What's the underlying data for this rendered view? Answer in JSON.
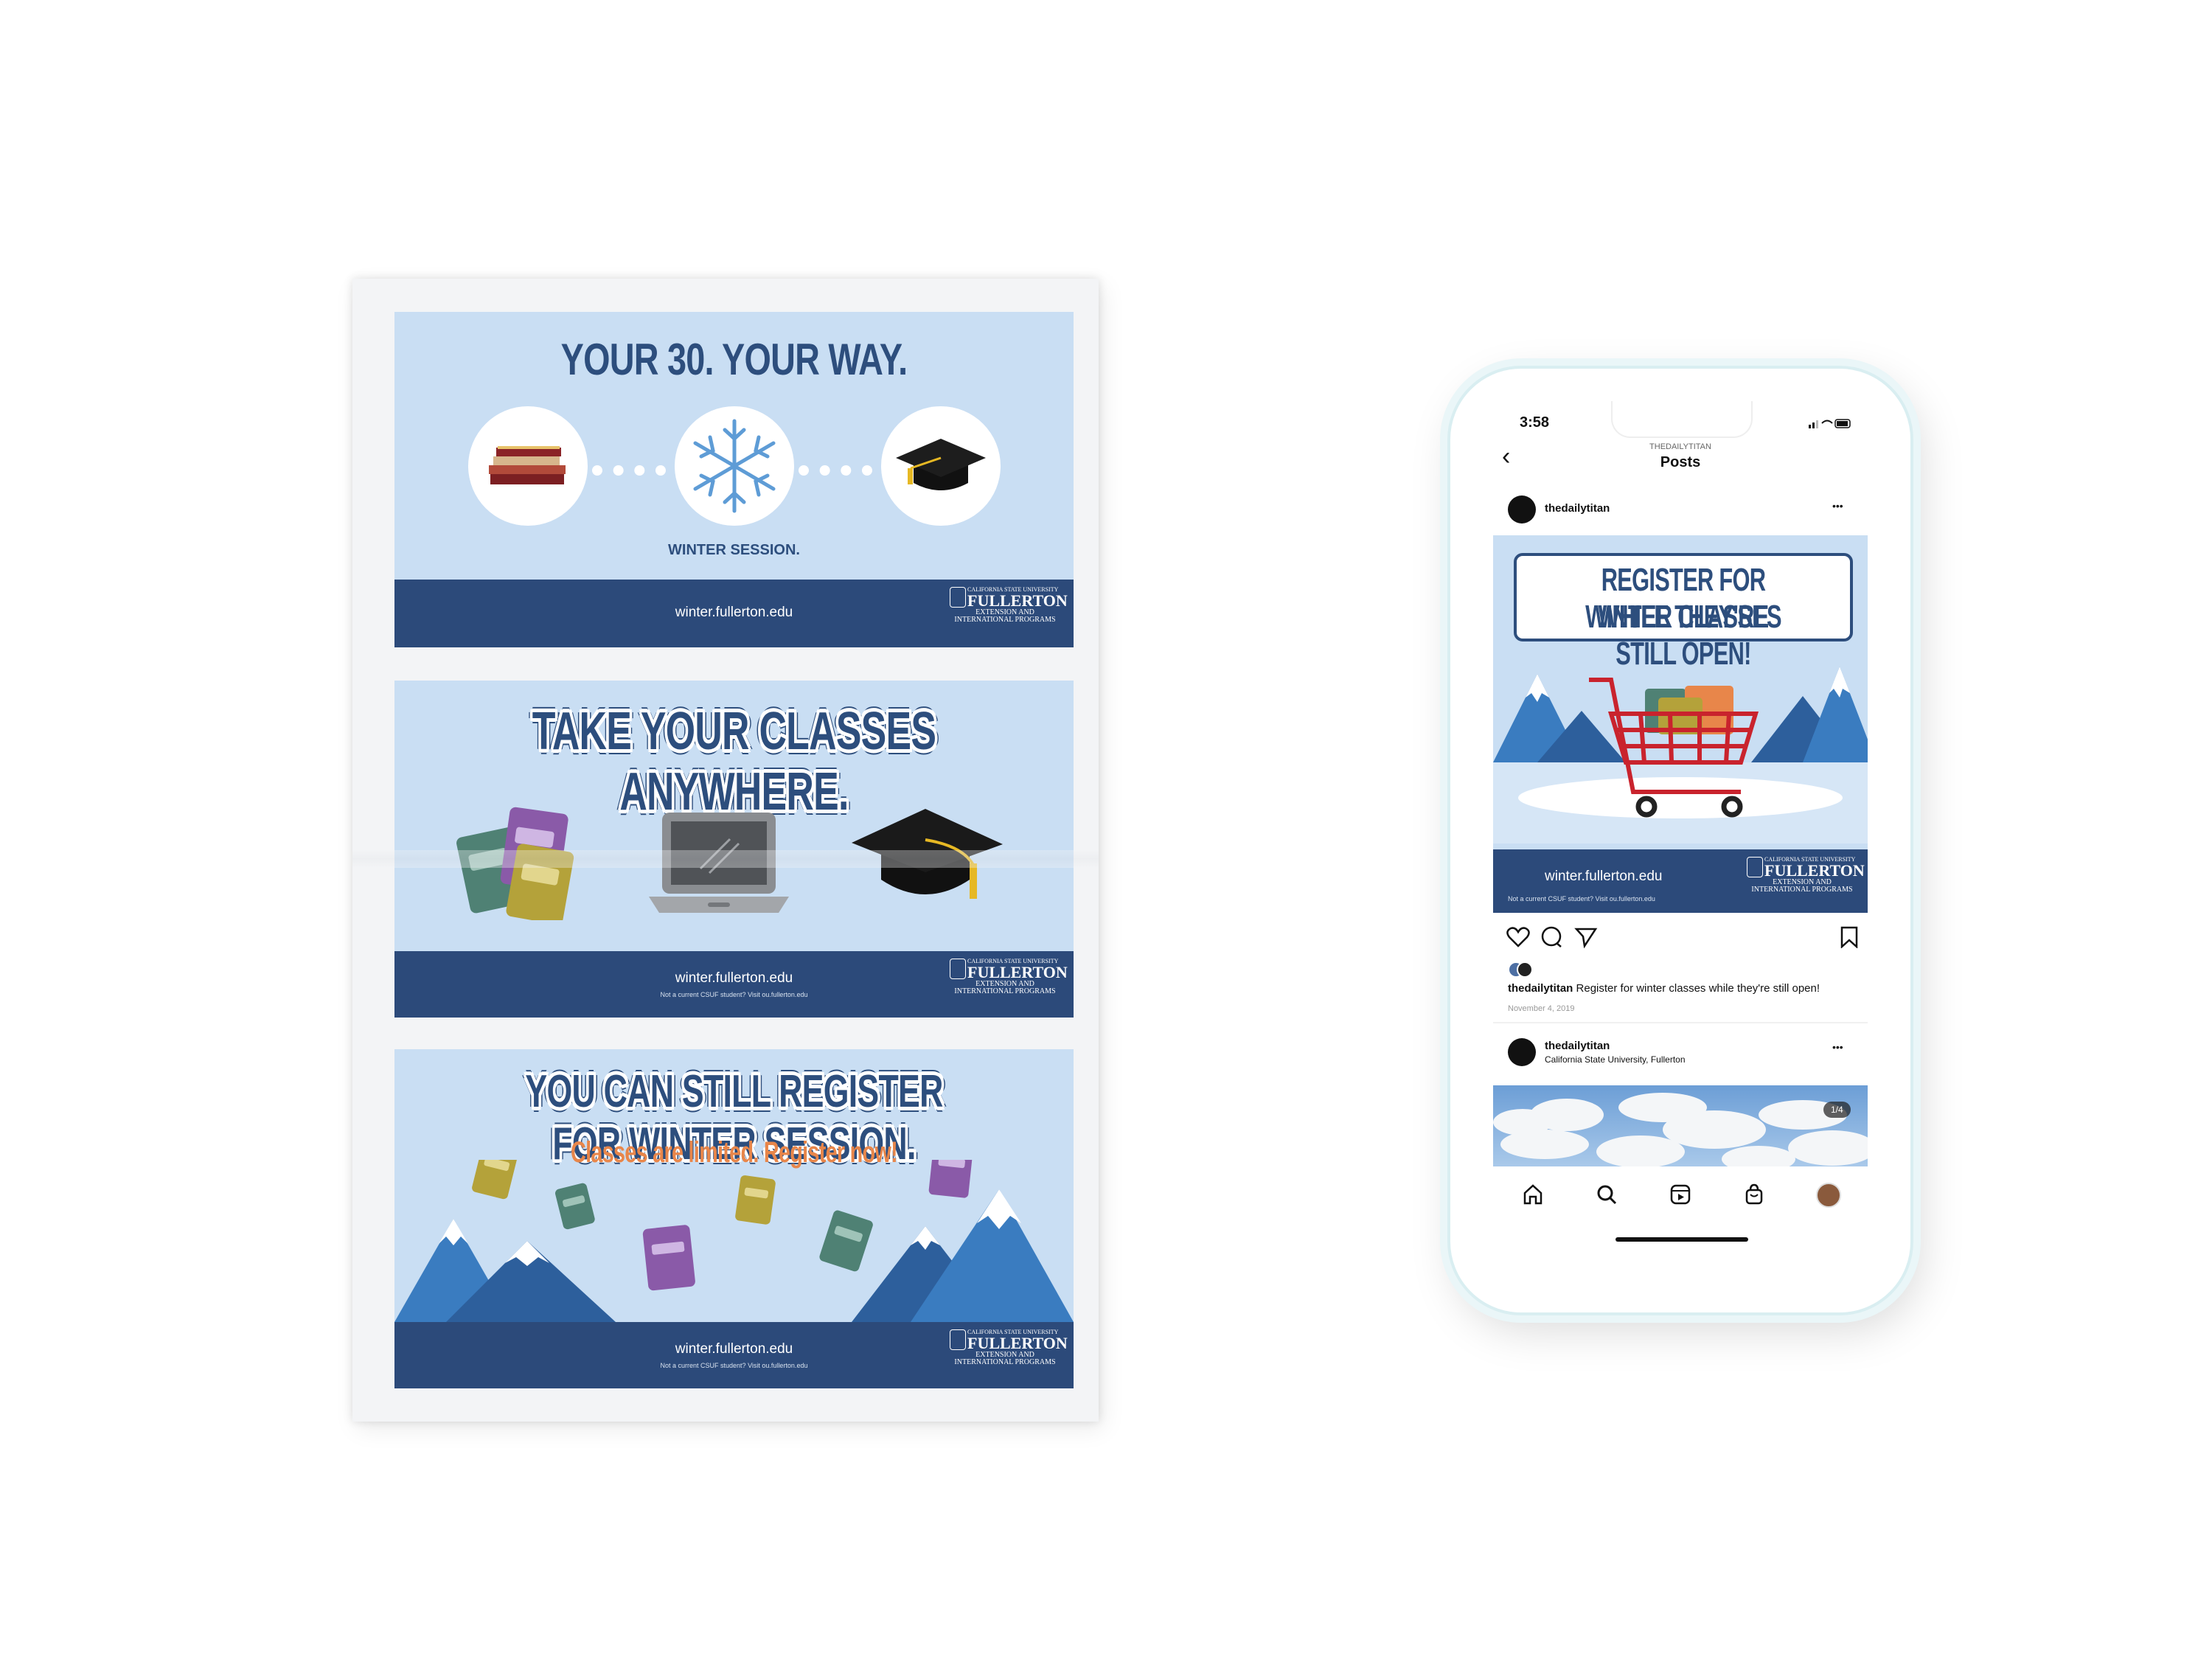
{
  "newspaper": {
    "ad1": {
      "title": "YOUR 30. YOUR WAY.",
      "subtitle": "WINTER SESSION.",
      "url": "winter.fullerton.edu",
      "logo": {
        "line1": "CALIFORNIA STATE UNIVERSITY",
        "line2": "FULLERTON",
        "line3": "EXTENSION AND",
        "line4": "INTERNATIONAL PROGRAMS"
      }
    },
    "ad2": {
      "title": "TAKE YOUR CLASSES ANYWHERE.",
      "url": "winter.fullerton.edu",
      "note": "Not a current CSUF student? Visit ou.fullerton.edu",
      "logo": {
        "line1": "CALIFORNIA STATE UNIVERSITY",
        "line2": "FULLERTON",
        "line3": "EXTENSION AND",
        "line4": "INTERNATIONAL PROGRAMS"
      }
    },
    "ad3": {
      "title": "YOU CAN STILL REGISTER FOR WINTER SESSION.",
      "tagline": "Classes are limited. Register now!",
      "url": "winter.fullerton.edu",
      "note": "Not a current CSUF student? Visit ou.fullerton.edu",
      "logo": {
        "line1": "CALIFORNIA STATE UNIVERSITY",
        "line2": "FULLERTON",
        "line3": "EXTENSION AND",
        "line4": "INTERNATIONAL PROGRAMS"
      }
    }
  },
  "phone": {
    "status": {
      "time": "3:58"
    },
    "header": {
      "account": "THEDAILYTITAN",
      "title": "Posts"
    },
    "post1": {
      "username": "thedailytitan",
      "more": "•••",
      "image": {
        "headline_line1": "REGISTER FOR WINTER CLASSES",
        "headline_line2": "WHILE THEY'RE STILL OPEN!",
        "url": "winter.fullerton.edu",
        "note": "Not a current CSUF student? Visit ou.fullerton.edu",
        "logo": {
          "line1": "CALIFORNIA STATE UNIVERSITY",
          "line2": "FULLERTON",
          "line3": "EXTENSION AND",
          "line4": "INTERNATIONAL PROGRAMS"
        }
      },
      "caption_user": "thedailytitan",
      "caption_text": "Register for winter classes while they're still open!",
      "date": "November 4, 2019"
    },
    "post2": {
      "username": "thedailytitan",
      "location": "California State University, Fullerton",
      "more": "•••",
      "counter": "1/4"
    },
    "nav": [
      "home-icon",
      "search-icon",
      "reels-icon",
      "shop-icon",
      "profile-avatar"
    ]
  },
  "colors": {
    "navy": "#2c4a7a",
    "light_blue": "#c9def3",
    "orange": "#e8864a",
    "red": "#c9232d"
  }
}
